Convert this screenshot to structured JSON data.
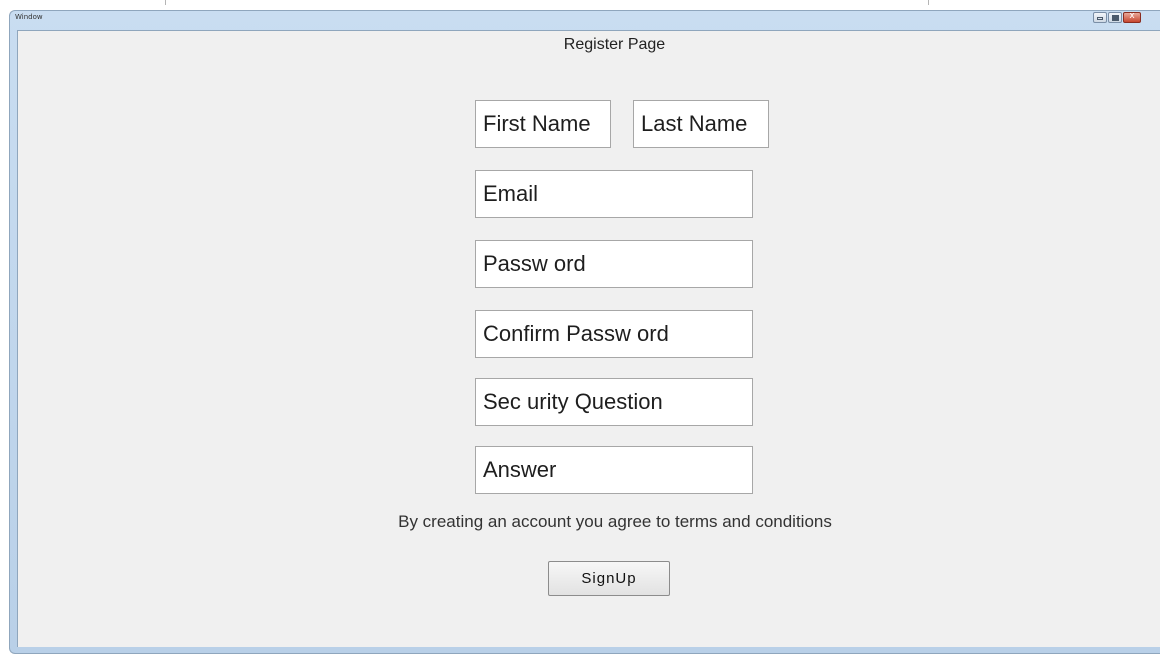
{
  "window": {
    "title": "Window",
    "controls": {
      "close_glyph": "x"
    }
  },
  "form": {
    "heading": "Register Page",
    "first_name_placeholder": "First Name",
    "last_name_placeholder": "Last Name",
    "email_placeholder": "Email",
    "password_placeholder": "Passw ord",
    "confirm_password_placeholder": "Confirm Passw ord",
    "security_question_placeholder": "Sec urity Question",
    "answer_placeholder": "Answer",
    "terms_text": "By creating an account you agree to terms and conditions",
    "signup_label": "SignUp"
  },
  "colors": {
    "window_frame": "#b9d0e8",
    "client_background": "#f0f0f0",
    "close_button": "#c7452e"
  }
}
